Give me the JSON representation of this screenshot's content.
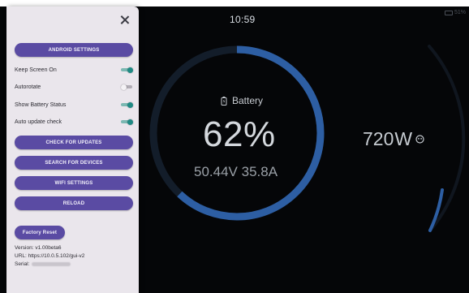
{
  "status_bar": {
    "time": "10:59",
    "battery_percent": "51%"
  },
  "gauge": {
    "label": "Battery",
    "percent_value": "62",
    "percent_sign": "%",
    "voltage": "50.44",
    "voltage_unit": "V",
    "current": "35.8",
    "current_unit": "A",
    "level_fraction": 0.62,
    "ring_color": "#2d5ea3",
    "ring_track_color": "#131d2a"
  },
  "power": {
    "value": "720",
    "unit": "W",
    "icon": "smiley-icon"
  },
  "drawer": {
    "close_icon": "close-icon",
    "android_settings": "ANDROID SETTINGS",
    "toggles": [
      {
        "label": "Keep Screen On",
        "on": true
      },
      {
        "label": "Autorotate",
        "on": false
      },
      {
        "label": "Show Battery Status",
        "on": true
      },
      {
        "label": "Auto update check",
        "on": true
      }
    ],
    "check_updates": "CHECK FOR UPDATES",
    "search_devices": "SEARCH FOR DEVICES",
    "wifi_settings": "WIFI SETTINGS",
    "reload": "RELOAD",
    "factory_reset": "Factory Reset",
    "version_label": "Version:",
    "version_value": "v1.00beta6",
    "url_label": "URL:",
    "url_value": "https://10.0.5.102/gui-v2",
    "serial_label": "Serial:"
  },
  "colors": {
    "button_bg": "#5a4ba3",
    "toggle_on": "#1f8a84",
    "drawer_bg": "#eae6ec",
    "screen_bg": "#050608"
  }
}
